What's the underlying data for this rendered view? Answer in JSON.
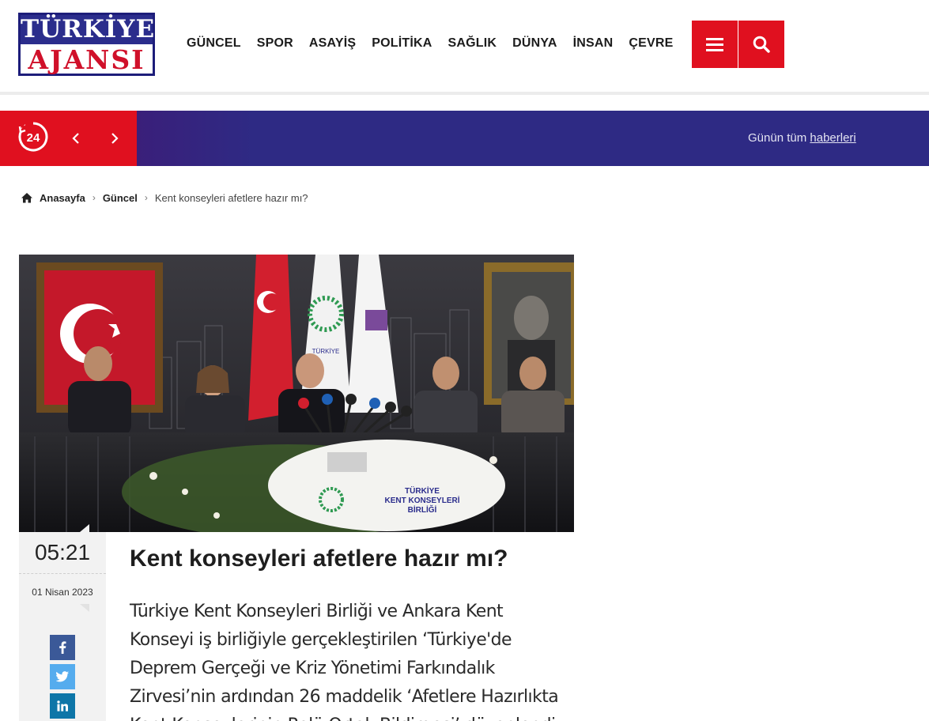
{
  "logo": {
    "line1": "TÜRKİYE",
    "line2": "AJANSI"
  },
  "nav": {
    "items": [
      "GÜNCEL",
      "SPOR",
      "ASAYİŞ",
      "POLİTİKA",
      "SAĞLIK",
      "DÜNYA",
      "İNSAN",
      "ÇEVRE"
    ]
  },
  "header": {
    "menu_icon": "hamburger-icon",
    "search_icon": "search-icon",
    "accent": "#e0101f"
  },
  "ticker": {
    "badge": "24",
    "prev_icon": "chevron-left-icon",
    "next_icon": "chevron-right-icon",
    "today_prefix": "Günün tüm",
    "today_link": "haberleri",
    "bg": "#2e2a84"
  },
  "breadcrumb": {
    "home": "Anasayfa",
    "category": "Güncel",
    "current": "Kent konseyleri afetlere hazır mı?"
  },
  "hero": {
    "banner_line1": "TÜRKİYE",
    "banner_line2": "KENT KONSEYLERİ",
    "banner_line3": "BİRLİĞİ",
    "flag_left": "TÜRKİYE"
  },
  "article": {
    "time": "05:21",
    "date": "01 Nisan 2023",
    "title": "Kent konseyleri afetlere hazır mı?",
    "lead": "Türkiye Kent Konseyleri Birliği ve Ankara Kent Konseyi iş birliğiyle gerçekleştirilen ‘Türkiye'de Deprem Gerçeği ve Kriz Yönetimi Farkındalık Zirvesi’nin ardından 26 maddelik ‘Afetlere Hazırlıkta Kent Konseylerinin Rolü Ortak Bildirgesi’ düzenlendi."
  },
  "share": {
    "facebook_icon": "facebook-icon",
    "twitter_icon": "twitter-icon",
    "linkedin_icon": "linkedin-icon"
  }
}
